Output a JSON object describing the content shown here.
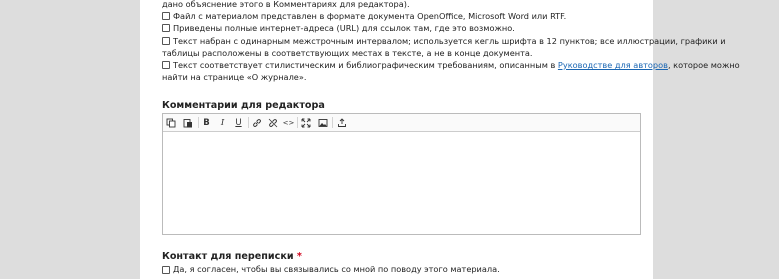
{
  "checklist": {
    "partial_top": "дано объяснение этого в Комментариях для редактора).",
    "items": [
      {
        "lines": [
          "Файл с материалом представлен в формате документа OpenOffice, Microsoft Word или RTF."
        ]
      },
      {
        "lines": [
          "Приведены полные интернет-адреса (URL) для ссылок там, где это возможно."
        ]
      },
      {
        "lines": [
          "Текст набран с одинарным межстрочным интервалом; используется кегль шрифта в 12 пунктов; все иллюстрации, графики и",
          "таблицы расположены в соответствующих местах в тексте, а не в конце документа."
        ]
      },
      {
        "line1_before": "Текст соответствует стилистическим и библиографическим требованиям, описанным в ",
        "line1_link": "Руководстве для авторов",
        "line1_after": ", которое можно",
        "line2": "найти на странице «О журнале»."
      }
    ]
  },
  "comments": {
    "label": "Комментарии для редактора",
    "toolbar": [
      {
        "icon": "copy-icon"
      },
      {
        "icon": "paste-icon"
      },
      {
        "icon": "bold-icon",
        "glyph": "B"
      },
      {
        "icon": "italic-icon",
        "glyph": "I"
      },
      {
        "icon": "underline-icon",
        "glyph": "U"
      },
      {
        "icon": "link-icon"
      },
      {
        "icon": "unlink-icon"
      },
      {
        "icon": "code-icon",
        "glyph": "<>"
      },
      {
        "icon": "fullscreen-icon"
      },
      {
        "icon": "image-icon"
      },
      {
        "icon": "upload-icon"
      }
    ],
    "value": ""
  },
  "contact": {
    "label": "Контакт для переписки",
    "required_mark": "*",
    "consent_text": "Да, я согласен, чтобы вы связывались со мной по поводу этого материала."
  }
}
